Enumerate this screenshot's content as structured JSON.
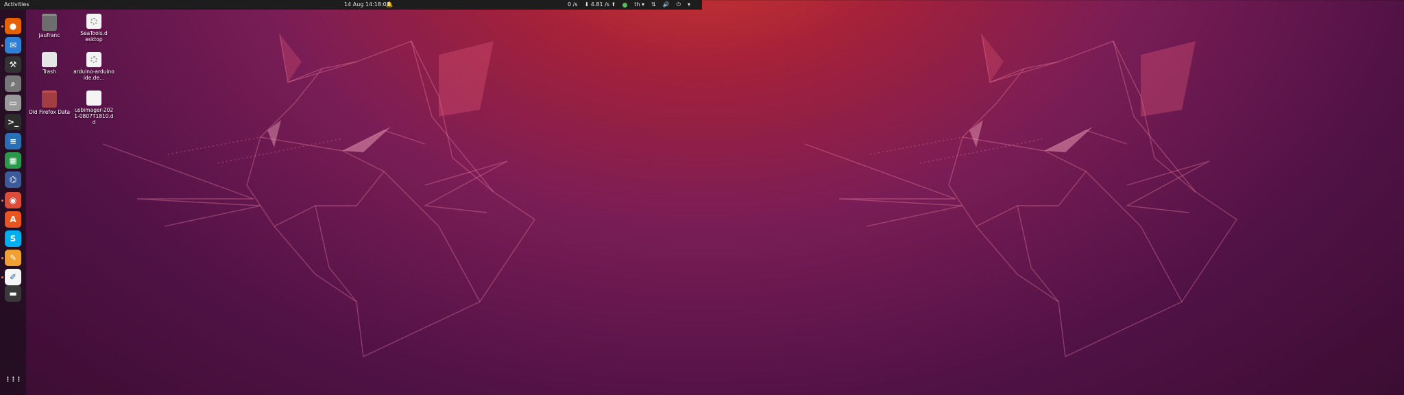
{
  "topbar": {
    "activities": "Activities",
    "clock": "14 Aug  14:18:02",
    "tray": {
      "item1": "0 /s",
      "item2": "4.81 /s",
      "lang": "th",
      "lang_arrow": "▾",
      "menu_arrow": "▾"
    }
  },
  "dock": {
    "apps": [
      {
        "name": "firefox-icon",
        "color": "#e66000",
        "glyph": "●"
      },
      {
        "name": "thunderbird-icon",
        "color": "#2f7fd6",
        "glyph": "✉"
      },
      {
        "name": "tool-icon",
        "color": "#333333",
        "glyph": "⚒"
      },
      {
        "name": "screenshot-icon",
        "color": "#777777",
        "glyph": "⌕"
      },
      {
        "name": "files-icon",
        "color": "#9a9a9a",
        "glyph": "▭"
      },
      {
        "name": "terminal-icon",
        "color": "#2c2c2c",
        "glyph": ">_"
      },
      {
        "name": "writer-icon",
        "color": "#2a6fb6",
        "glyph": "≡"
      },
      {
        "name": "calc-icon",
        "color": "#2a9a4a",
        "glyph": "▦"
      },
      {
        "name": "network-icon",
        "color": "#3a5a9a",
        "glyph": "⌬"
      },
      {
        "name": "chrome-icon",
        "color": "#dd4b39",
        "glyph": "◉"
      },
      {
        "name": "software-center-icon",
        "color": "#e95420",
        "glyph": "A"
      },
      {
        "name": "skype-icon",
        "color": "#00aff0",
        "glyph": "S"
      },
      {
        "name": "paint-icon",
        "color": "#f0a030",
        "glyph": "✎"
      },
      {
        "name": "text-editor-icon",
        "color": "#f5f5f5",
        "glyph": "✐"
      },
      {
        "name": "drive-icon",
        "color": "#3a3a3a",
        "glyph": "▬"
      },
      {
        "name": "app-grid-icon",
        "color": "transparent",
        "glyph": "⋮⋮⋮"
      }
    ]
  },
  "desktop": {
    "icons": [
      {
        "label": "jaufranc",
        "type": "folder-grey"
      },
      {
        "label": "SeaTools.desktop",
        "type": "doc-gear"
      },
      {
        "label": "Trash",
        "type": "trash"
      },
      {
        "label": "arduino-arduinoide.de...",
        "type": "doc-gear"
      },
      {
        "label": "Old Firefox Data",
        "type": "folder-red"
      },
      {
        "label": "usbimager-2021-0807T1810.dd",
        "type": "doc"
      }
    ]
  },
  "colors": {
    "topbar": "#1d1d1d",
    "accent": "#e95420",
    "wallpaper_top": "#d63b2a",
    "wallpaper_bottom": "#3b0d33"
  }
}
